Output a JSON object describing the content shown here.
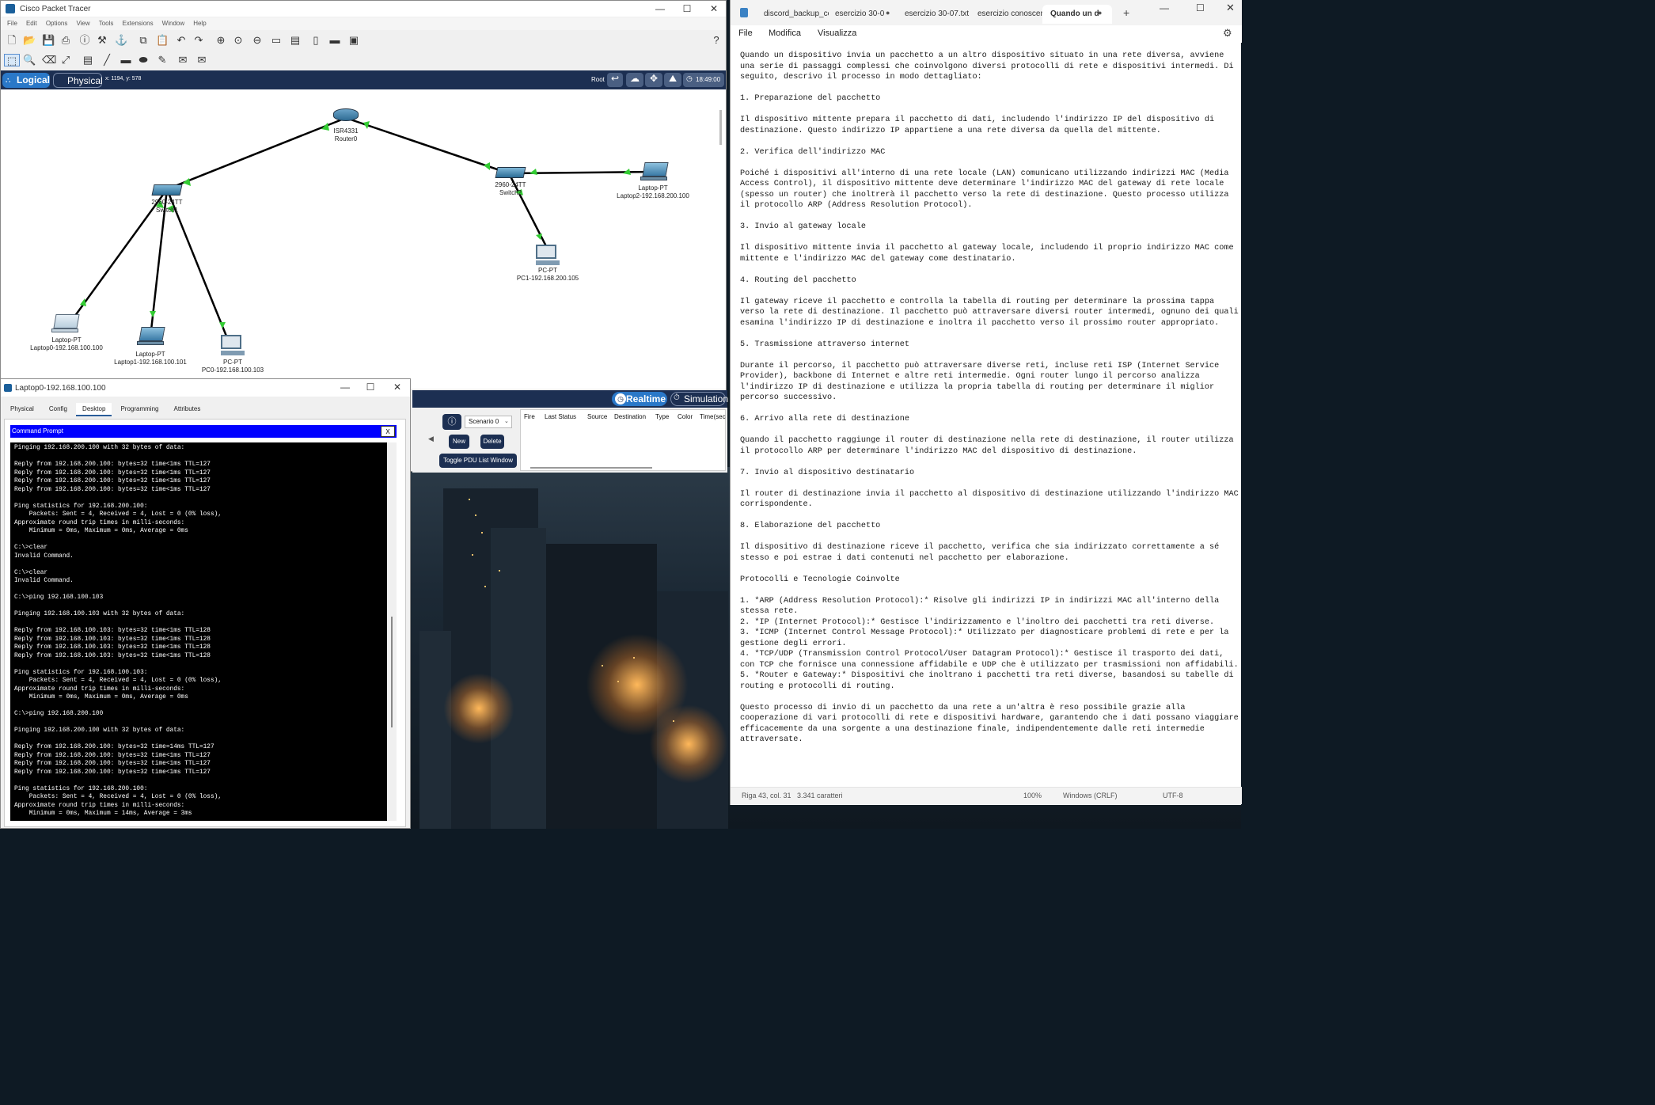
{
  "pt": {
    "title": "Cisco Packet Tracer",
    "menu": [
      "File",
      "Edit",
      "Options",
      "View",
      "Tools",
      "Extensions",
      "Window",
      "Help"
    ],
    "nav": {
      "logical": "Logical",
      "physical": "Physical",
      "coords": "x: 1194, y: 578",
      "root": "Root",
      "clock": "18:49:00"
    },
    "devices": [
      {
        "model": "ISR4331",
        "label": "Router0"
      },
      {
        "model": "2960-24TT",
        "label": "Switch1"
      },
      {
        "model": "2960-24TT",
        "label": "Switch2"
      },
      {
        "model": "Laptop-PT",
        "label": "Laptop2-192.168.200.100"
      },
      {
        "model": "PC-PT",
        "label": "PC1-192.168.200.105"
      },
      {
        "model": "Laptop-PT",
        "label": "Laptop0-192.168.100.100"
      },
      {
        "model": "Laptop-PT",
        "label": "Laptop1-192.168.100.101"
      },
      {
        "model": "PC-PT",
        "label": "PC0-192.168.100.103"
      }
    ],
    "sim": {
      "realtime": "Realtime",
      "simulation": "Simulation"
    },
    "pdu": {
      "scenario": "Scenario 0",
      "new": "New",
      "delete": "Delete",
      "toggle": "Toggle PDU List Window",
      "columns": [
        "Fire",
        "Last Status",
        "Source",
        "Destination",
        "Type",
        "Color",
        "Time(sec"
      ]
    }
  },
  "laptop": {
    "title": "Laptop0-192.168.100.100",
    "tabs": [
      "Physical",
      "Config",
      "Desktop",
      "Programming",
      "Attributes"
    ],
    "active_tab": "Desktop",
    "cmd_title": "Command Prompt",
    "close": "X",
    "lines": [
      "Pinging 192.168.200.100 with 32 bytes of data:",
      "",
      "Reply from 192.168.200.100: bytes=32 time<1ms TTL=127",
      "Reply from 192.168.200.100: bytes=32 time<1ms TTL=127",
      "Reply from 192.168.200.100: bytes=32 time<1ms TTL=127",
      "Reply from 192.168.200.100: bytes=32 time<1ms TTL=127",
      "",
      "Ping statistics for 192.168.200.100:",
      "    Packets: Sent = 4, Received = 4, Lost = 0 (0% loss),",
      "Approximate round trip times in milli-seconds:",
      "    Minimum = 0ms, Maximum = 0ms, Average = 0ms",
      "",
      "C:\\>clear",
      "Invalid Command.",
      "",
      "C:\\>clear",
      "Invalid Command.",
      "",
      "C:\\>ping 192.168.100.103",
      "",
      "Pinging 192.168.100.103 with 32 bytes of data:",
      "",
      "Reply from 192.168.100.103: bytes=32 time<1ms TTL=128",
      "Reply from 192.168.100.103: bytes=32 time<1ms TTL=128",
      "Reply from 192.168.100.103: bytes=32 time<1ms TTL=128",
      "Reply from 192.168.100.103: bytes=32 time<1ms TTL=128",
      "",
      "Ping statistics for 192.168.100.103:",
      "    Packets: Sent = 4, Received = 4, Lost = 0 (0% loss),",
      "Approximate round trip times in milli-seconds:",
      "    Minimum = 0ms, Maximum = 0ms, Average = 0ms",
      "",
      "C:\\>ping 192.168.200.100",
      "",
      "Pinging 192.168.200.100 with 32 bytes of data:",
      "",
      "Reply from 192.168.200.100: bytes=32 time=14ms TTL=127",
      "Reply from 192.168.200.100: bytes=32 time<1ms TTL=127",
      "Reply from 192.168.200.100: bytes=32 time<1ms TTL=127",
      "Reply from 192.168.200.100: bytes=32 time<1ms TTL=127",
      "",
      "Ping statistics for 192.168.200.100:",
      "    Packets: Sent = 4, Received = 4, Lost = 0 (0% loss),",
      "Approximate round trip times in milli-seconds:",
      "    Minimum = 0ms, Maximum = 14ms, Average = 3ms"
    ]
  },
  "notepad": {
    "tabs": [
      "discord_backup_coc",
      "esercizio 30-0",
      "esercizio 30-07.txt",
      "esercizio conoscenz",
      "Quando un d"
    ],
    "active_tab": "Quando un d",
    "menu": [
      "File",
      "Modifica",
      "Visualizza"
    ],
    "body": "Quando un dispositivo invia un pacchetto a un altro dispositivo situato in una rete diversa, avviene una serie di passaggi complessi che coinvolgono diversi protocolli di rete e dispositivi intermedi. Di seguito, descrivo il processo in modo dettagliato:\n\n1. Preparazione del pacchetto\n\nIl dispositivo mittente prepara il pacchetto di dati, includendo l'indirizzo IP del dispositivo di destinazione. Questo indirizzo IP appartiene a una rete diversa da quella del mittente.\n\n2. Verifica dell'indirizzo MAC\n\nPoiché i dispositivi all'interno di una rete locale (LAN) comunicano utilizzando indirizzi MAC (Media Access Control), il dispositivo mittente deve determinare l'indirizzo MAC del gateway di rete locale (spesso un router) che inoltrerà il pacchetto verso la rete di destinazione. Questo processo utilizza il protocollo ARP (Address Resolution Protocol).\n\n3. Invio al gateway locale\n\nIl dispositivo mittente invia il pacchetto al gateway locale, includendo il proprio indirizzo MAC come mittente e l'indirizzo MAC del gateway come destinatario.\n\n4. Routing del pacchetto\n\nIl gateway riceve il pacchetto e controlla la tabella di routing per determinare la prossima tappa verso la rete di destinazione. Il pacchetto può attraversare diversi router intermedi, ognuno dei quali esamina l'indirizzo IP di destinazione e inoltra il pacchetto verso il prossimo router appropriato.\n\n5. Trasmissione attraverso internet\n\nDurante il percorso, il pacchetto può attraversare diverse reti, incluse reti ISP (Internet Service Provider), backbone di Internet e altre reti intermedie. Ogni router lungo il percorso analizza l'indirizzo IP di destinazione e utilizza la propria tabella di routing per determinare il miglior percorso successivo.\n\n6. Arrivo alla rete di destinazione\n\nQuando il pacchetto raggiunge il router di destinazione nella rete di destinazione, il router utilizza il protocollo ARP per determinare l'indirizzo MAC del dispositivo di destinazione.\n\n7. Invio al dispositivo destinatario\n\nIl router di destinazione invia il pacchetto al dispositivo di destinazione utilizzando l'indirizzo MAC corrispondente.\n\n8. Elaborazione del pacchetto\n\nIl dispositivo di destinazione riceve il pacchetto, verifica che sia indirizzato correttamente a sé stesso e poi estrae i dati contenuti nel pacchetto per elaborazione.\n\nProtocolli e Tecnologie Coinvolte\n\n1. *ARP (Address Resolution Protocol):* Risolve gli indirizzi IP in indirizzi MAC all'interno della stessa rete.\n2. *IP (Internet Protocol):* Gestisce l'indirizzamento e l'inoltro dei pacchetti tra reti diverse.\n3. *ICMP (Internet Control Message Protocol):* Utilizzato per diagnosticare problemi di rete e per la gestione degli errori.\n4. *TCP/UDP (Transmission Control Protocol/User Datagram Protocol):* Gestisce il trasporto dei dati, con TCP che fornisce una connessione affidabile e UDP che è utilizzato per trasmissioni non affidabili.\n5. *Router e Gateway:* Dispositivi che inoltrano i pacchetti tra reti diverse, basandosi su tabelle di routing e protocolli di routing.\n\nQuesto processo di invio di un pacchetto da una rete a un'altra è reso possibile grazie alla cooperazione di vari protocolli di rete e dispositivi hardware, garantendo che i dati possano viaggiare efficacemente da una sorgente a una destinazione finale, indipendentemente dalle reti intermedie attraversate.",
    "status": {
      "pos": "Riga 43, col. 31",
      "chars": "3.341 caratteri",
      "zoom": "100%",
      "eol": "Windows (CRLF)",
      "enc": "UTF-8"
    }
  }
}
